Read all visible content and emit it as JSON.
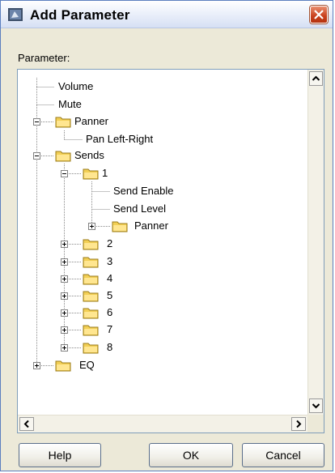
{
  "window": {
    "title": "Add Parameter",
    "icon": "app-icon",
    "close_icon": "close-icon"
  },
  "parameter_label": "Parameter:",
  "tree": {
    "volume": "Volume",
    "mute": "Mute",
    "panner": "Panner",
    "pan_left_right": "Pan Left-Right",
    "sends": "Sends",
    "send_1": "1",
    "send_enable": "Send Enable",
    "send_level": "Send Level",
    "send_1_panner": "Panner",
    "send_2": "2",
    "send_3": "3",
    "send_4": "4",
    "send_5": "5",
    "send_6": "6",
    "send_7": "7",
    "send_8": "8",
    "eq": "EQ"
  },
  "buttons": {
    "help": "Help",
    "ok": "OK",
    "cancel": "Cancel"
  },
  "colors": {
    "title_bar": "#dbe4f6",
    "close": "#c8401c",
    "folder": "#f2cf55",
    "window_bg": "#ece9d8",
    "tree_border": "#7f9db9"
  }
}
